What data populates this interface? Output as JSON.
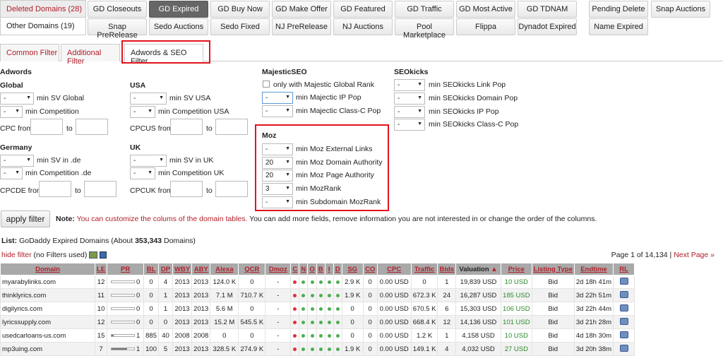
{
  "lists": {
    "deleted": "Deleted Domains (28)",
    "other": "Other Domains (19)"
  },
  "sources_row1": [
    "GD Closeouts",
    "GD Expired",
    "GD Buy Now",
    "GD Make Offer",
    "GD Featured",
    "GD Traffic",
    "GD Most Active",
    "GD TDNAM",
    "Pending Delete",
    "Snap Auctions"
  ],
  "sources_row2": [
    "Snap PreRelease",
    "Sedo Auctions",
    "Sedo Fixed",
    "NJ PreRelease",
    "NJ Auctions",
    "Pool Marketplace",
    "Flippa",
    "Dynadot Expired",
    "Name Expired"
  ],
  "active_source": "GD Expired",
  "filter_tabs": [
    "Common Filter",
    "Additional Filter",
    "Adwords & SEO Filter"
  ],
  "adwords": {
    "title": "Adwords",
    "global": "Global",
    "usa": "USA",
    "germany": "Germany",
    "uk": "UK",
    "min_sv_global": "min SV Global",
    "min_competition": "min Competition",
    "cpc_from": "CPC from",
    "to": "to",
    "min_sv_usa": "min SV USA",
    "min_comp_usa": "min Competition USA",
    "cpcus_from": "CPCUS from",
    "min_sv_de": "min SV in .de",
    "min_comp_de": "min Competition .de",
    "cpcde_from": "CPCDE from",
    "min_sv_uk": "min SV in UK",
    "min_comp_uk": "min Competition UK",
    "cpcuk_from": "CPCUK from",
    "dash": "-"
  },
  "majestic": {
    "title": "MajesticSEO",
    "only_global": "only with Majestic Global Rank",
    "ip_pop": "min Majectic IP Pop",
    "classc_pop": "min Majectic Class-C Pop"
  },
  "moz": {
    "title": "Moz",
    "ext_links": "min Moz External Links",
    "da": "min Moz Domain Authority",
    "pa": "min Moz Page Authority",
    "mozrank": "min MozRank",
    "sub_mozrank": "min Subdomain MozRank",
    "v_ext": "-",
    "v_da": "20",
    "v_pa": "20",
    "v_rank": "3",
    "v_sub": "-"
  },
  "seokicks": {
    "title": "SEOkicks",
    "link_pop": "min SEOkicks Link Pop",
    "domain_pop": "min SEOkicks Domain Pop",
    "ip_pop": "min SEOkicks IP Pop",
    "classc_pop": "min SEOkicks Class-C Pop"
  },
  "apply_filter": "apply filter",
  "note_label": "Note:",
  "note_text": "You can customize the colums of the domain tables.",
  "note_rest": "You can add more fields, remove information you are not interested in or change the order of the columns.",
  "list_label": "List:",
  "list_desc": "GoDaddy Expired Domains (About ",
  "list_count": "353,343",
  "list_tail": " Domains)",
  "hide_filter": "hide filter",
  "no_filters": "(no Filters used)",
  "page_info": "Page 1 of 14,134 |",
  "next_page": "Next Page »",
  "columns": [
    "Domain",
    "LE",
    "PR",
    "BL",
    "DP",
    "WBY",
    "ABY",
    "Alexa",
    "QCR",
    "Dmoz",
    "C",
    "N",
    "O",
    "B",
    "I",
    "D",
    "SG",
    "CO",
    "CPC",
    "Traffic",
    "Bids",
    "Valuation",
    "Price",
    "Listing Type",
    "Endtime",
    "RL"
  ],
  "rows": [
    {
      "domain": "myarabylinks.com",
      "le": "12",
      "pr": "0",
      "prf": 0,
      "bl": "0",
      "dp": "4",
      "wby": "2013",
      "aby": "2013",
      "alexa": "124.0 K",
      "qcr": "0",
      "dmoz": "-",
      "dots": [
        "r",
        "g",
        "g",
        "g",
        "g",
        "g"
      ],
      "sg": "2.9 K",
      "co": "0",
      "cpc": "0.00 USD",
      "traffic": "0",
      "bids": "1",
      "val": "19,839 USD",
      "price": "10 USD",
      "lt": "Bid",
      "end": "2d 18h 41m"
    },
    {
      "domain": "thinklyrics.com",
      "le": "11",
      "pr": "0",
      "prf": 0,
      "bl": "0",
      "dp": "1",
      "wby": "2013",
      "aby": "2013",
      "alexa": "7.1 M",
      "qcr": "710.7 K",
      "dmoz": "-",
      "dots": [
        "r",
        "g",
        "g",
        "g",
        "g",
        "g"
      ],
      "sg": "1.9 K",
      "co": "0",
      "cpc": "0.00 USD",
      "traffic": "672.3 K",
      "bids": "24",
      "val": "16,287 USD",
      "price": "185 USD",
      "lt": "Bid",
      "end": "3d 22h 51m"
    },
    {
      "domain": "digilyrics.com",
      "le": "10",
      "pr": "0",
      "prf": 0,
      "bl": "0",
      "dp": "1",
      "wby": "2013",
      "aby": "2013",
      "alexa": "5.6 M",
      "qcr": "0",
      "dmoz": "-",
      "dots": [
        "r",
        "g",
        "g",
        "g",
        "g",
        "g"
      ],
      "sg": "0",
      "co": "0",
      "cpc": "0.00 USD",
      "traffic": "670.5 K",
      "bids": "6",
      "val": "15,303 USD",
      "price": "106 USD",
      "lt": "Bid",
      "end": "3d 22h 44m"
    },
    {
      "domain": "lyricssupply.com",
      "le": "12",
      "pr": "0",
      "prf": 0,
      "bl": "0",
      "dp": "0",
      "wby": "2013",
      "aby": "2013",
      "alexa": "15.2 M",
      "qcr": "545.5 K",
      "dmoz": "-",
      "dots": [
        "r",
        "g",
        "g",
        "g",
        "g",
        "g"
      ],
      "sg": "0",
      "co": "0",
      "cpc": "0.00 USD",
      "traffic": "668.4 K",
      "bids": "12",
      "val": "14,136 USD",
      "price": "101 USD",
      "lt": "Bid",
      "end": "3d 21h 28m"
    },
    {
      "domain": "usedcarloans-us.com",
      "le": "15",
      "pr": "1",
      "prf": 0.1,
      "bl": "885",
      "dp": "40",
      "wby": "2008",
      "aby": "2008",
      "alexa": "0",
      "qcr": "0",
      "dmoz": "-",
      "dots": [
        "r",
        "g",
        "g",
        "g",
        "g",
        "g"
      ],
      "sg": "0",
      "co": "0",
      "cpc": "0.00 USD",
      "traffic": "1.2 K",
      "bids": "1",
      "val": "4,158 USD",
      "price": "10 USD",
      "lt": "Bid",
      "end": "4d 18h 30m"
    },
    {
      "domain": "mp3uing.com",
      "le": "7",
      "pr": "1",
      "prf": 0.7,
      "bl": "100",
      "dp": "5",
      "wby": "2013",
      "aby": "2013",
      "alexa": "328.5 K",
      "qcr": "274.9 K",
      "dmoz": "-",
      "dots": [
        "r",
        "g",
        "g",
        "g",
        "g",
        "g"
      ],
      "sg": "1.9 K",
      "co": "0",
      "cpc": "0.00 USD",
      "traffic": "149.1 K",
      "bids": "4",
      "val": "4,032 USD",
      "price": "27 USD",
      "lt": "Bid",
      "end": "3d 20h 38m"
    }
  ]
}
